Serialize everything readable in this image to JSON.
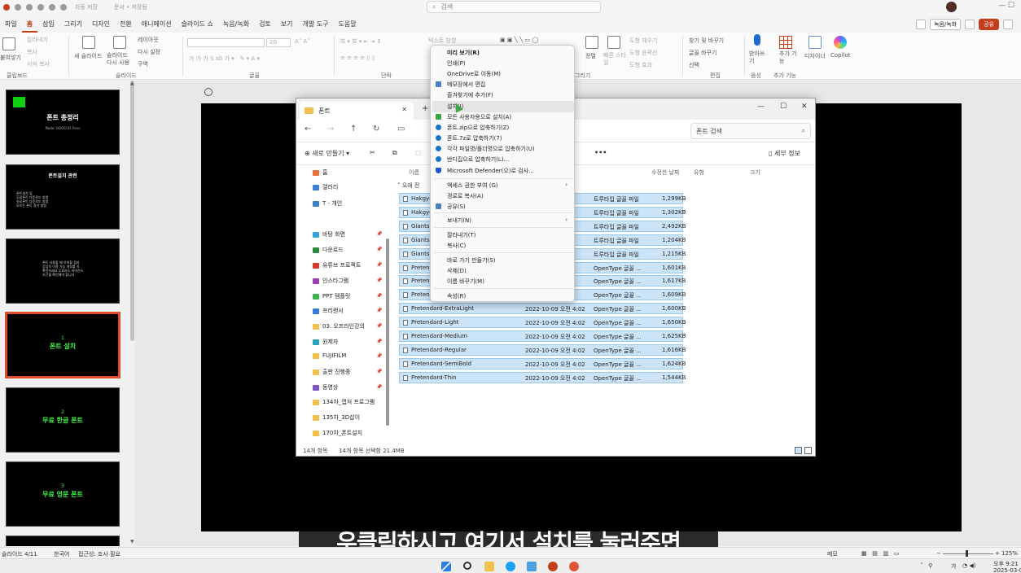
{
  "ppt": {
    "titlebar": {
      "autosave_label": "자동 저장",
      "doc_name": "문서 • 저장됨",
      "search_placeholder": "검색"
    },
    "tabs": [
      "파일",
      "홈",
      "삽입",
      "그리기",
      "디자인",
      "전환",
      "애니메이션",
      "슬라이드 쇼",
      "녹음/녹화",
      "검토",
      "보기",
      "개발 도구",
      "도움말"
    ],
    "active_tab": "홈",
    "record_button": "녹음/녹화",
    "share_button": "공유",
    "ribbon": {
      "paste": "붙여넣기",
      "cut": "잘라내기",
      "copy": "복사",
      "format_painter": "서식 복사",
      "new_slide": "새 슬라이드",
      "reuse_slide": "슬라이드 다시 사용",
      "layout": "레이아웃",
      "reset": "다시 설정",
      "section": "구역",
      "text_direction": "텍스트 방향",
      "font_size": "20",
      "arrange": "정렬",
      "quick_styles": "빠른 스타일",
      "shape_fill": "도형 채우기",
      "shape_outline": "도형 윤곽선",
      "shape_effects": "도형 효과",
      "find": "찾기 및 바꾸기",
      "replace": "글꼴 바꾸기",
      "select": "선택",
      "dictate": "받아쓰기",
      "addins": "추가 기능",
      "designer": "디자이너",
      "copilot": "Copilot",
      "groups": {
        "clipboard": "클립보드",
        "slides": "슬라이드",
        "font": "글꼴",
        "paragraph": "단락",
        "drawing": "그리기",
        "editing": "편집",
        "voice": "음성",
        "addins": "추가 기능"
      }
    },
    "slides": [
      {
        "title": "폰트 총정리",
        "sub": "Made: OOOO.01.Pxxx"
      },
      {
        "title": "폰트설치 관련",
        "lines": "폰트설치 팁\n무료폰트 다운로드 방법\n유료폰트 다운로드 방법\n모르는 폰트 찾기 방법"
      },
      {
        "title": "",
        "lines": "폰트 사용할 때 유의할 점과\n상업적 이용 가능 여부를 꼭\n확인하세요 무료라도 라이선스\n조건을 확인해야 합니다"
      },
      {
        "num": "1",
        "title": "폰트 설치"
      },
      {
        "num": "2",
        "title": "무료 한글 폰트"
      },
      {
        "num": "3",
        "title": "무료 영문 폰트"
      }
    ],
    "status": {
      "slide_counter": "슬라이드 4/11",
      "language": "한국어",
      "accessibility": "접근성: 조사 필요",
      "notes": "메모",
      "zoom": "125%"
    }
  },
  "explorer": {
    "tab_title": "폰트",
    "search_placeholder": "폰트 검색",
    "toolbar": {
      "new": "새로 만들기",
      "more": "•••",
      "details": "세부 정보"
    },
    "sidebar": [
      {
        "label": "홈",
        "color": "#e8733a",
        "pinned": false
      },
      {
        "label": "갤러리",
        "color": "#3b7fd6",
        "pinned": false
      },
      {
        "label": "T - 개인",
        "color": "#3b82c4",
        "pinned": false
      },
      {
        "label": "바탕 화면",
        "color": "#3aa0d8",
        "pinned": true
      },
      {
        "label": "다운로드",
        "color": "#2b8a3e",
        "pinned": true
      },
      {
        "label": "유튜브 프로젝트",
        "color": "#d33a2c",
        "pinned": true
      },
      {
        "label": "인스타그램",
        "color": "#9b3fb5",
        "pinned": true
      },
      {
        "label": "PPT 템플릿",
        "color": "#3fb34f",
        "pinned": true
      },
      {
        "label": "프리랜서",
        "color": "#3a7ad8",
        "pinned": true
      },
      {
        "label": "03. 오프라인강의",
        "color": "#f0c14b",
        "pinned": true
      },
      {
        "label": "원제자",
        "color": "#2ba3b8",
        "pinned": true
      },
      {
        "label": "FUJIFILM",
        "color": "#f0c14b",
        "pinned": true
      },
      {
        "label": "출판 진행중",
        "color": "#f0c14b",
        "pinned": true
      },
      {
        "label": "동영상",
        "color": "#7e57c2",
        "pinned": true
      },
      {
        "label": "134차_캡처 프로그램",
        "color": "#f0c14b",
        "pinned": false
      },
      {
        "label": "135차_3D삽이",
        "color": "#f0c14b",
        "pinned": false
      },
      {
        "label": "170차_폰트설치",
        "color": "#f0c14b",
        "pinned": false
      }
    ],
    "columns": {
      "name": "이름",
      "date": "수정한 날짜",
      "type": "유형",
      "size": "크기"
    },
    "group_label": "오래 전",
    "files": [
      {
        "name": "Hakgyo",
        "date": "58",
        "type": "트루타입 글꼴 파일",
        "size": "1,299KB"
      },
      {
        "name": "Hakgyo",
        "date": "58",
        "type": "트루타입 글꼴 파일",
        "size": "1,302KB"
      },
      {
        "name": "Giants-",
        "date": ":53",
        "type": "트루타입 글꼴 파일",
        "size": "2,492KB"
      },
      {
        "name": "Giants-",
        "date": ":53",
        "type": "트루타입 글꼴 파일",
        "size": "1,204KB"
      },
      {
        "name": "Giants-",
        "date": ":53",
        "type": "트루타입 글꼴 파일",
        "size": "1,215KB"
      },
      {
        "name": "Pretend",
        "date": "4:02",
        "type": "OpenType 글꼴 ...",
        "size": "1,601KB"
      },
      {
        "name": "Pretend",
        "date": "4:02",
        "type": "OpenType 글꼴 ...",
        "size": "1,617KB"
      },
      {
        "name": "Pretend",
        "date": "4:02",
        "type": "OpenType 글꼴 ...",
        "size": "1,609KB"
      },
      {
        "name": "Pretendard-ExtraLight",
        "date": "2022-10-09 오전 4:02",
        "type": "OpenType 글꼴 ...",
        "size": "1,600KB"
      },
      {
        "name": "Pretendard-Light",
        "date": "2022-10-09 오전 4:02",
        "type": "OpenType 글꼴 ...",
        "size": "1,650KB"
      },
      {
        "name": "Pretendard-Medium",
        "date": "2022-10-09 오전 4:02",
        "type": "OpenType 글꼴 ...",
        "size": "1,625KB"
      },
      {
        "name": "Pretendard-Regular",
        "date": "2022-10-09 오전 4:02",
        "type": "OpenType 글꼴 ...",
        "size": "1,616KB"
      },
      {
        "name": "Pretendard-SemiBold",
        "date": "2022-10-09 오전 4:02",
        "type": "OpenType 글꼴 ...",
        "size": "1,624KB"
      },
      {
        "name": "Pretendard-Thin",
        "date": "2022-10-09 오전 4:02",
        "type": "OpenType 글꼴 ...",
        "size": "1,544KB"
      }
    ],
    "status_count": "14개 항목",
    "status_selected": "14개 항목 선택함 21.4MB"
  },
  "context_menu": {
    "items": [
      {
        "label": "미리 보기(R)",
        "bold": true,
        "icon": ""
      },
      {
        "label": "인쇄(P)",
        "icon": ""
      },
      {
        "label": "OneDrive로 이동(M)",
        "icon": ""
      },
      {
        "label": "메모장에서 편집",
        "icon": "notepad-icon"
      },
      {
        "label": "즐겨찾기에 추가(F)",
        "icon": ""
      },
      {
        "label": "설치(I)",
        "icon": "",
        "hover": true
      },
      {
        "label": "모든 사용자용으로 설치(A)",
        "icon": "shield-install-icon"
      },
      {
        "label": "폰트.zip으로 압축하기(Z)",
        "icon": "bandizip-icon"
      },
      {
        "label": "폰트.7z로 압축하기(7)",
        "icon": "bandizip-icon"
      },
      {
        "label": "각각 파일명/폴더명으로 압축하기(U)",
        "icon": "bandizip-icon"
      },
      {
        "label": "반디집으로 압축하기(L)...",
        "icon": "bandizip-icon"
      },
      {
        "label": "Microsoft Defender(으)로 검사...",
        "icon": "defender-icon"
      },
      {
        "label": "액세스 권한 부여 (G)",
        "icon": "",
        "submenu": true
      },
      {
        "label": "경로로 복사(A)",
        "icon": ""
      },
      {
        "label": "공유(S)",
        "icon": "share-icon"
      },
      {
        "label": "보내기(N)",
        "icon": "",
        "submenu": true
      },
      {
        "label": "잘라내기(T)",
        "icon": ""
      },
      {
        "label": "복사(C)",
        "icon": ""
      },
      {
        "label": "바로 가기 만들기(S)",
        "icon": ""
      },
      {
        "label": "삭제(D)",
        "icon": ""
      },
      {
        "label": "이름 바꾸기(M)",
        "icon": ""
      },
      {
        "label": "속성(R)",
        "icon": ""
      }
    ]
  },
  "subtitle": "우클릭하시고 여기서 설치를 눌러주면",
  "taskbar": {
    "ime": "가",
    "time": "오후 9:21",
    "date": "2025-03-09"
  },
  "colors": {
    "accent": "#c43e1c",
    "selection": "#cce4f7",
    "slide_green": "#3ef24a"
  }
}
